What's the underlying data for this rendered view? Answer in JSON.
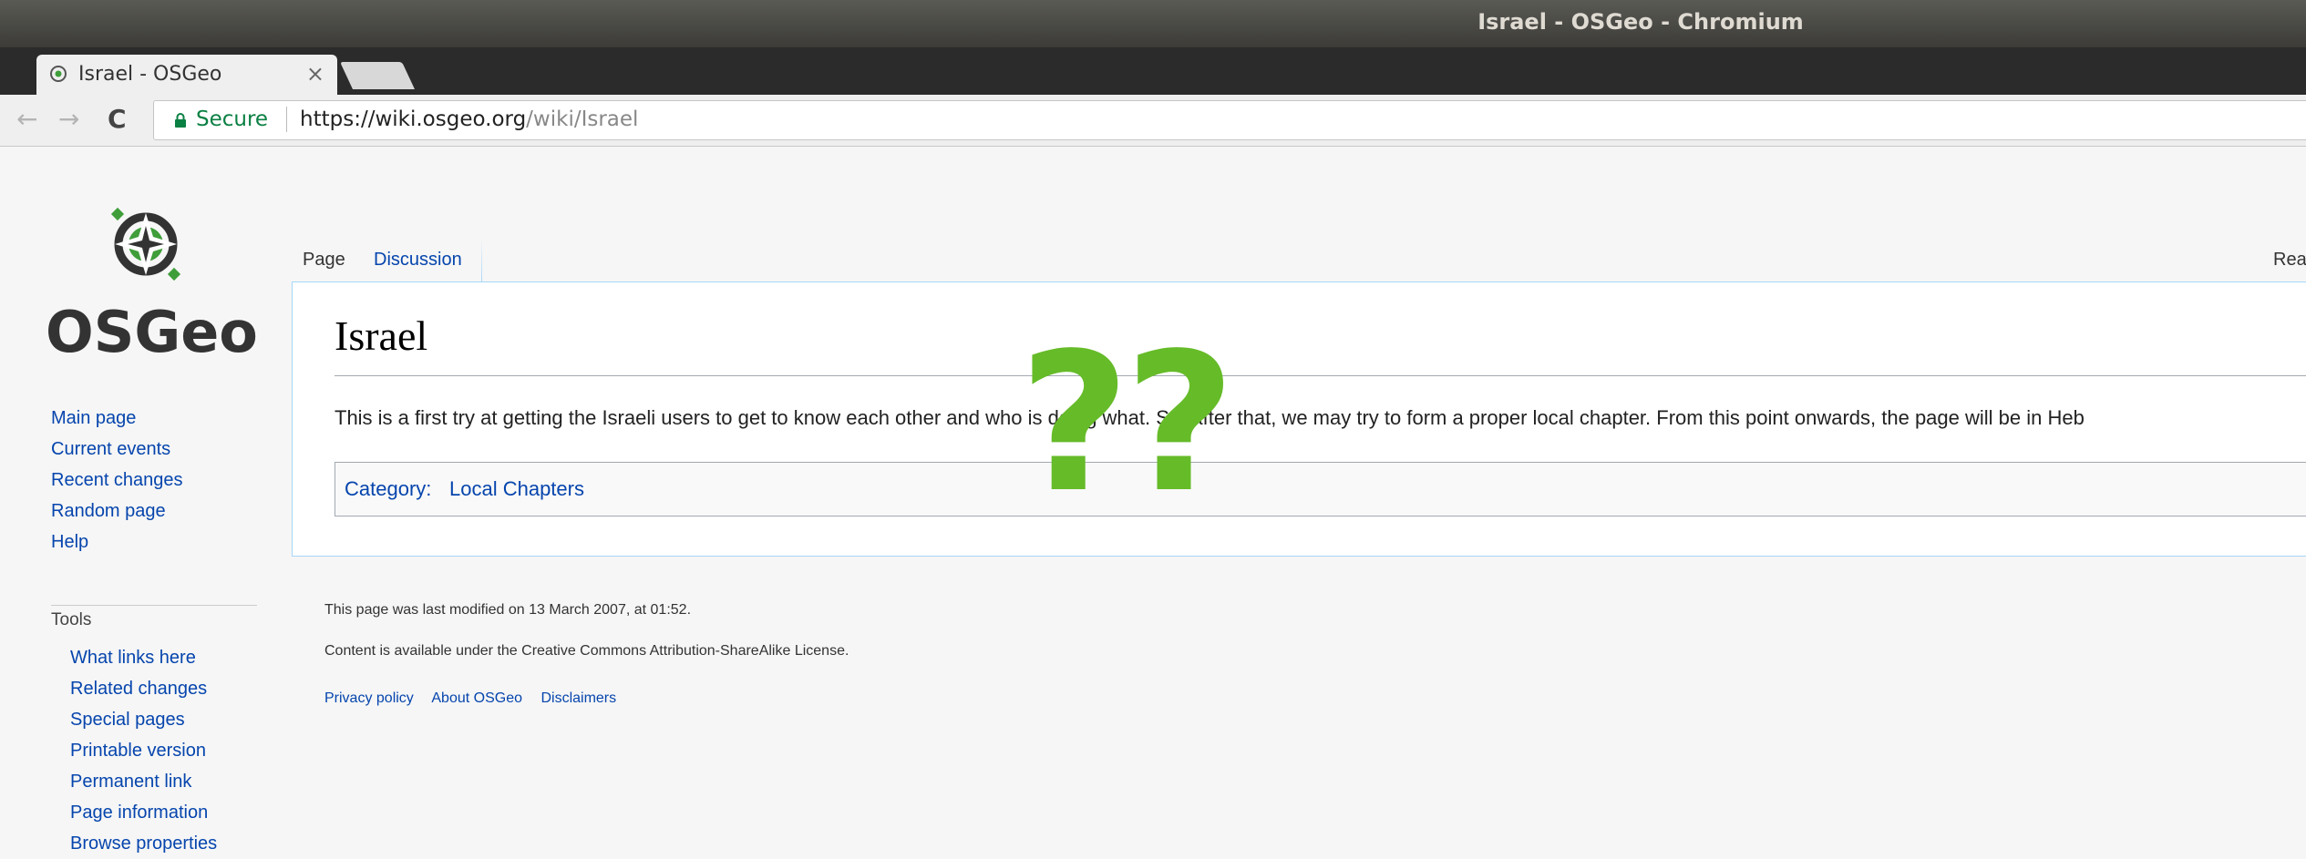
{
  "window": {
    "title": "Israel - OSGeo - Chromium"
  },
  "browser": {
    "tab_title": "Israel - OSGeo",
    "tab_close": "×",
    "secure_label": "Secure",
    "url_host": "https://wiki.osgeo.org",
    "url_path": "/wiki/Israel",
    "back": "←",
    "forward": "→",
    "reload": "C"
  },
  "logo": {
    "text": "OSGeo",
    "colors": {
      "green": "#3f9e3a",
      "dark": "#333333"
    }
  },
  "sidebar": {
    "navigation": [
      "Main page",
      "Current events",
      "Recent changes",
      "Random page",
      "Help"
    ],
    "tools_heading": "Tools",
    "tools": [
      "What links here",
      "Related changes",
      "Special pages",
      "Printable version",
      "Permanent link",
      "Page information",
      "Browse properties"
    ]
  },
  "page_tabs": {
    "page": "Page",
    "discussion": "Discussion",
    "read": "Rea"
  },
  "article": {
    "title": "Israel",
    "body": "This is a first try at getting the Israeli users to get to know each other and who is doing what. So, after that, we may try to form a proper local chapter. From this point onwards, the page will be in Heb",
    "category_label": "Category:",
    "category_link": "Local Chapters"
  },
  "footer": {
    "last_modified": "This page was last modified on 13 March 2007, at 01:52.",
    "license": "Content is available under the Creative Commons Attribution-ShareAlike License.",
    "links": [
      "Privacy policy",
      "About OSGeo",
      "Disclaimers"
    ]
  },
  "overlay": {
    "text": "??",
    "color": "#66bb29"
  }
}
